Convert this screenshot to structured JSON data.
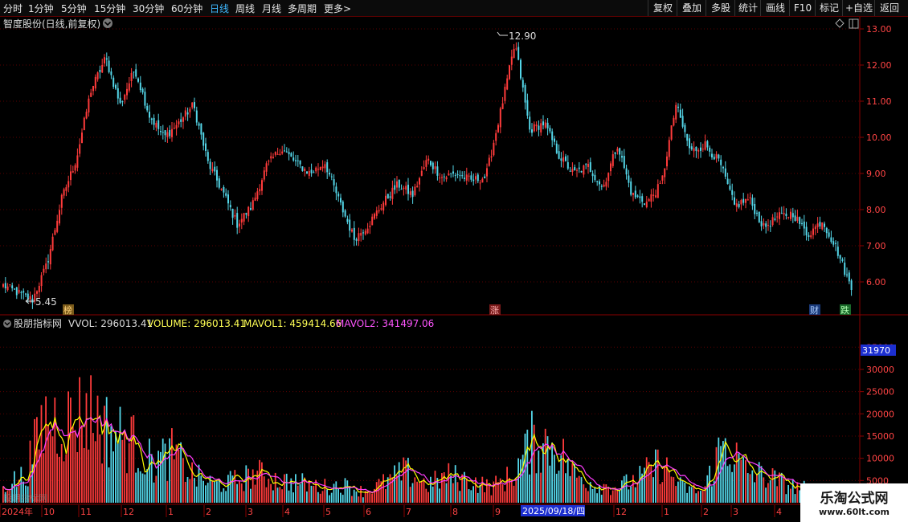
{
  "toolbar": {
    "periods": [
      "分时",
      "1分钟",
      "5分钟",
      "15分钟",
      "30分钟",
      "60分钟",
      "日线",
      "周线",
      "月线",
      "多周期",
      "更多"
    ],
    "more_arrow": ">",
    "active_period": "日线",
    "right_buttons": [
      "复权",
      "叠加",
      "多股",
      "统计",
      "画线",
      "F10",
      "标记",
      "+自选",
      "返回"
    ]
  },
  "main_panel": {
    "title": "智度股份(日线,前复权)",
    "high_label": "12.90",
    "low_label": "5.45",
    "price_ticks": [
      "13.00",
      "12.00",
      "11.00",
      "10.00",
      "9.00",
      "8.00",
      "7.00",
      "6.00"
    ],
    "markers": [
      "榜",
      "涨",
      "财",
      "跌"
    ]
  },
  "indicator_panel": {
    "name": "股朋指标网",
    "vwol": "VVOL: 296013.41",
    "volume": "VOLUME: 296013.41",
    "mavol1": "MAVOL1: 459414.66",
    "mavol2": "MAVOL2: 341497.06",
    "cursor_value": "31970",
    "vol_ticks": [
      "35000",
      "30000",
      "25000",
      "20000",
      "15000",
      "10000",
      "5000"
    ]
  },
  "date_axis": {
    "labels": [
      "2024年",
      "10",
      "11",
      "12",
      "1",
      "2",
      "3",
      "4",
      "5",
      "6",
      "7",
      "8",
      "9",
      "2025/09/18/四",
      "12",
      "1",
      "2",
      "3",
      "4"
    ]
  },
  "overlay_text": "股朋指标网",
  "watermark": {
    "line1": "乐淘公式网",
    "line2": "www.60lt.com"
  },
  "colors": {
    "up": "#ff3b3b",
    "down": "#54d6e8",
    "ma1": "#ffff00",
    "ma2": "#ff3cff",
    "active": "#3fb8ff"
  },
  "chart_data": {
    "type": "candlestick",
    "close_price_path": [
      5.9,
      5.7,
      5.5,
      6.5,
      8.3,
      9.4,
      11.3,
      12.2,
      10.9,
      11.9,
      10.6,
      10.0,
      10.4,
      10.9,
      9.3,
      8.5,
      7.6,
      8.1,
      9.2,
      9.7,
      9.3,
      9.0,
      9.3,
      8.2,
      7.2,
      7.6,
      8.2,
      8.7,
      8.4,
      9.4,
      8.9,
      9.0,
      8.8,
      8.9,
      10.7,
      12.6,
      10.2,
      10.4,
      9.5,
      9.0,
      9.2,
      8.6,
      9.8,
      8.4,
      8.2,
      8.7,
      10.9,
      9.6,
      9.8,
      9.3,
      8.1,
      8.3,
      7.5,
      7.8,
      7.9,
      7.3,
      7.7,
      6.9,
      5.8
    ],
    "volume_series": [
      4000,
      6000,
      19000,
      18000,
      21000,
      16000,
      14000,
      9000,
      11000,
      6000,
      4000,
      5000,
      6500,
      5000,
      4500,
      3500,
      4000,
      2500,
      4500,
      7000,
      4000,
      6000,
      5000,
      3500,
      6000,
      14000,
      13000,
      6000,
      4000,
      3500,
      5500,
      9000,
      3500,
      2500,
      14000,
      7000,
      6000,
      4000,
      3000,
      2500,
      2000
    ]
  }
}
